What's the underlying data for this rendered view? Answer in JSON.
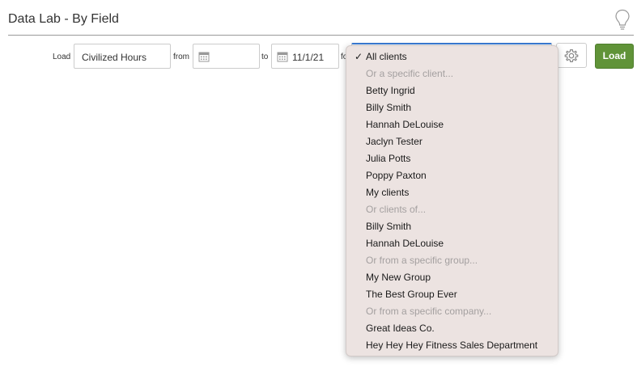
{
  "header": {
    "title": "Data Lab - By Field",
    "help_icon": "lightbulb-icon"
  },
  "toolbar": {
    "load_label": "Load",
    "field_value": "Civilized Hours",
    "from_label": "from",
    "from_date": "",
    "to_label": "to",
    "to_date": "11/1/21",
    "for_label": "fo",
    "settings_icon": "gear-icon",
    "load_button": "Load",
    "load_button_color": "#609338"
  },
  "dropdown": {
    "options": [
      {
        "label": "All clients",
        "selected": true,
        "disabled": false
      },
      {
        "label": "Or a specific client...",
        "selected": false,
        "disabled": true
      },
      {
        "label": "Betty Ingrid",
        "selected": false,
        "disabled": false
      },
      {
        "label": "Billy Smith",
        "selected": false,
        "disabled": false
      },
      {
        "label": "Hannah DeLouise",
        "selected": false,
        "disabled": false
      },
      {
        "label": "Jaclyn Tester",
        "selected": false,
        "disabled": false
      },
      {
        "label": "Julia Potts",
        "selected": false,
        "disabled": false
      },
      {
        "label": "Poppy Paxton",
        "selected": false,
        "disabled": false
      },
      {
        "label": "My clients",
        "selected": false,
        "disabled": false
      },
      {
        "label": "Or clients of...",
        "selected": false,
        "disabled": true
      },
      {
        "label": "Billy Smith",
        "selected": false,
        "disabled": false
      },
      {
        "label": "Hannah DeLouise",
        "selected": false,
        "disabled": false
      },
      {
        "label": "Or from a specific group...",
        "selected": false,
        "disabled": true
      },
      {
        "label": "My New Group",
        "selected": false,
        "disabled": false
      },
      {
        "label": "The Best Group Ever",
        "selected": false,
        "disabled": false
      },
      {
        "label": "Or from a specific company...",
        "selected": false,
        "disabled": true
      },
      {
        "label": "Great Ideas Co.",
        "selected": false,
        "disabled": false
      },
      {
        "label": "Hey Hey Hey Fitness Sales Department",
        "selected": false,
        "disabled": false
      }
    ]
  }
}
